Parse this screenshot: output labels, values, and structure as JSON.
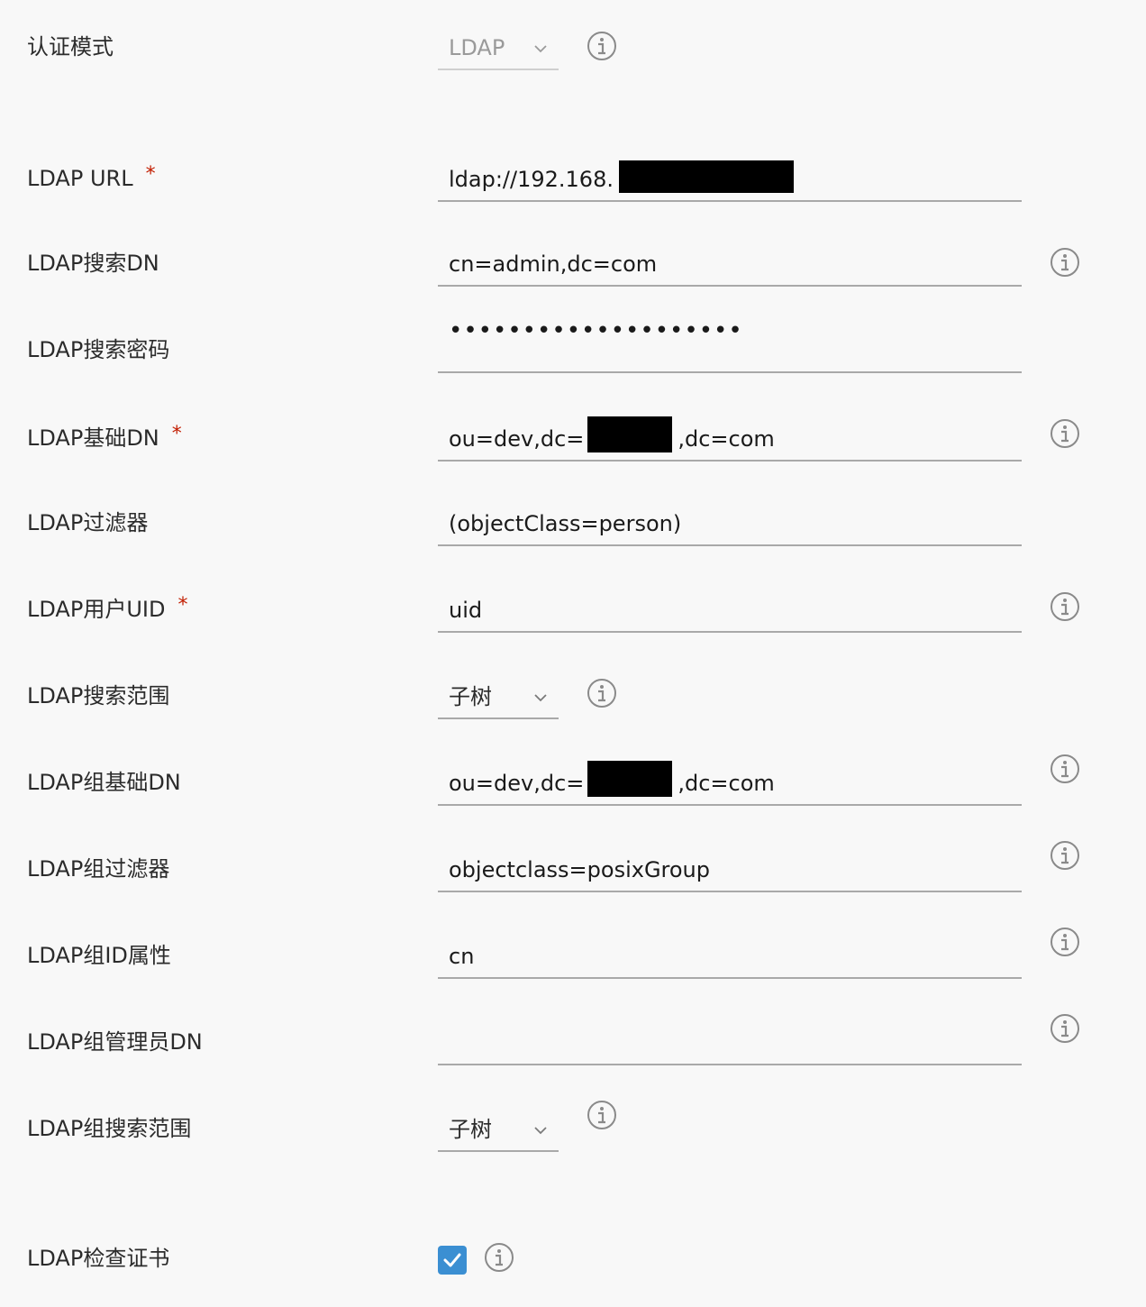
{
  "form": {
    "auth_mode": {
      "label": "认证模式",
      "value": "LDAP"
    },
    "ldap_url": {
      "label": "LDAP URL",
      "required_mark": "*",
      "value": "ldap://192.168."
    },
    "search_dn": {
      "label": "LDAP搜索DN",
      "value": "cn=admin,dc=com"
    },
    "search_password": {
      "label": "LDAP搜索密码",
      "value": "••••••••••••••••••••"
    },
    "base_dn": {
      "label": "LDAP基础DN",
      "required_mark": "*",
      "value_prefix": "ou=dev,dc=",
      "value_suffix": ",dc=com"
    },
    "filter": {
      "label": "LDAP过滤器",
      "value": "(objectClass=person)"
    },
    "uid": {
      "label": "LDAP用户UID",
      "required_mark": "*",
      "value": "uid"
    },
    "search_scope": {
      "label": "LDAP搜索范围",
      "value": "子树"
    },
    "group_base_dn": {
      "label": "LDAP组基础DN",
      "value_prefix": "ou=dev,dc=",
      "value_suffix": ",dc=com"
    },
    "group_filter": {
      "label": "LDAP组过滤器",
      "value": "objectclass=posixGroup"
    },
    "group_id_attr": {
      "label": "LDAP组ID属性",
      "value": "cn"
    },
    "group_admin_dn": {
      "label": "LDAP组管理员DN",
      "value": ""
    },
    "group_search_scope": {
      "label": "LDAP组搜索范围",
      "value": "子树"
    },
    "verify_cert": {
      "label": "LDAP检查证书",
      "checked": true
    }
  },
  "icons": {
    "info": "info-circle-icon",
    "chevron": "chevron-down-icon",
    "check": "checkmark-icon"
  },
  "colors": {
    "background": "#f8f8f8",
    "required": "#c21d00",
    "checkbox": "#3b8fd2",
    "underline": "#a9a9a9",
    "icon": "#8a8a8a"
  }
}
